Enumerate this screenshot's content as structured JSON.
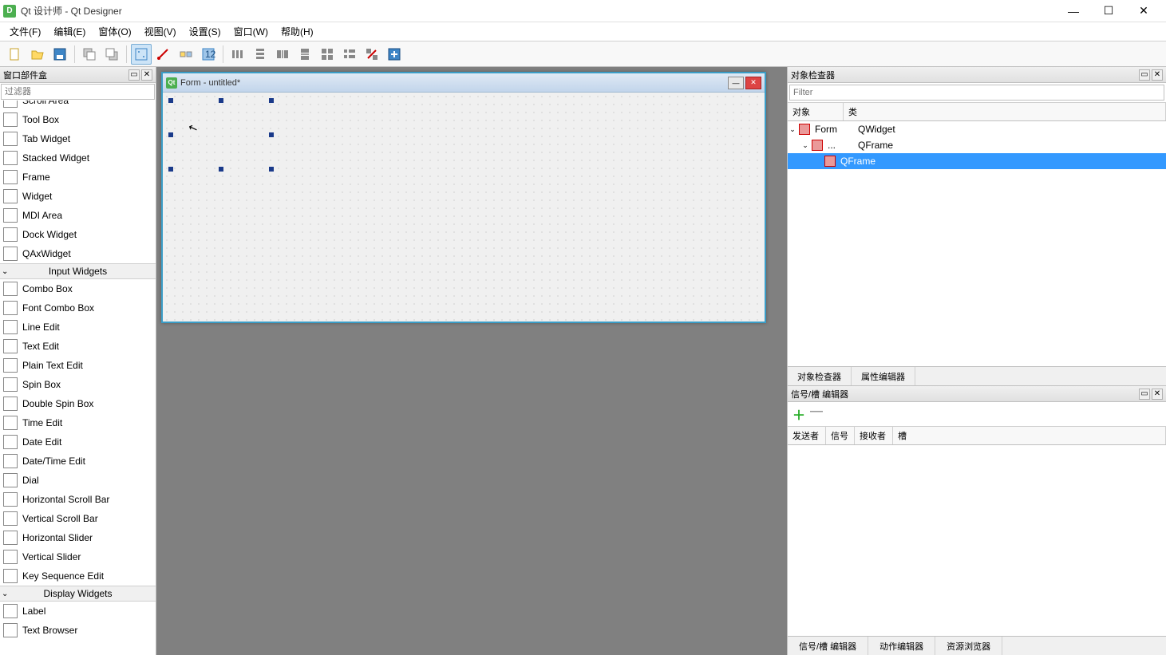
{
  "app": {
    "icon_letter": "D",
    "title": "Qt 设计师 - Qt Designer"
  },
  "menu": {
    "file": "文件(F)",
    "edit": "编辑(E)",
    "form": "窗体(O)",
    "view": "视图(V)",
    "settings": "设置(S)",
    "window": "窗口(W)",
    "help": "帮助(H)"
  },
  "widgetbox": {
    "title": "窗口部件盒",
    "filter_placeholder": "过滤器",
    "items_top": [
      {
        "name": "Scroll Area",
        "icon": "ic-gray",
        "clipped": true
      },
      {
        "name": "Tool Box",
        "icon": "ic-yellow"
      },
      {
        "name": "Tab Widget",
        "icon": "ic-green"
      },
      {
        "name": "Stacked Widget",
        "icon": "ic-green"
      },
      {
        "name": "Frame",
        "icon": "ic-stripe"
      },
      {
        "name": "Widget",
        "icon": "ic-stripe"
      },
      {
        "name": "MDI Area",
        "icon": "ic-gray"
      },
      {
        "name": "Dock Widget",
        "icon": "ic-gray"
      },
      {
        "name": "QAxWidget",
        "icon": "ic-gray"
      }
    ],
    "group_input": "Input Widgets",
    "items_input": [
      {
        "name": "Combo Box",
        "icon": "ic-gray"
      },
      {
        "name": "Font Combo Box",
        "icon": "ic-red"
      },
      {
        "name": "Line Edit",
        "icon": "ic-gray"
      },
      {
        "name": "Text Edit",
        "icon": "ic-blue"
      },
      {
        "name": "Plain Text Edit",
        "icon": "ic-blue"
      },
      {
        "name": "Spin Box",
        "icon": "ic-gray"
      },
      {
        "name": "Double Spin Box",
        "icon": "ic-gray"
      },
      {
        "name": "Time Edit",
        "icon": "ic-blue"
      },
      {
        "name": "Date Edit",
        "icon": "ic-gray"
      },
      {
        "name": "Date/Time Edit",
        "icon": "ic-gray"
      },
      {
        "name": "Dial",
        "icon": "ic-green"
      },
      {
        "name": "Horizontal Scroll Bar",
        "icon": "ic-yellow"
      },
      {
        "name": "Vertical Scroll Bar",
        "icon": "ic-yellow"
      },
      {
        "name": "Horizontal Slider",
        "icon": "ic-yellow"
      },
      {
        "name": "Vertical Slider",
        "icon": "ic-yellow"
      },
      {
        "name": "Key Sequence Edit",
        "icon": "ic-gray"
      }
    ],
    "group_display": "Display Widgets",
    "items_display": [
      {
        "name": "Label",
        "icon": "ic-yellow"
      },
      {
        "name": "Text Browser",
        "icon": "ic-blue"
      }
    ]
  },
  "canvas": {
    "form_title": "Form - untitled*",
    "qt_icon": "Qt"
  },
  "inspector": {
    "title": "对象检查器",
    "filter_placeholder": "Filter",
    "col_object": "对象",
    "col_class": "类",
    "tree": [
      {
        "indent": 0,
        "open": true,
        "obj": "Form",
        "cls": "QWidget",
        "icon": "ic-red"
      },
      {
        "indent": 1,
        "open": true,
        "obj": "...",
        "cls": "QFrame",
        "icon": "ic-red"
      },
      {
        "indent": 2,
        "open": false,
        "obj": "",
        "cls": "QFrame",
        "icon": "ic-red",
        "selected": true,
        "showcls_in_obj": true
      }
    ],
    "tab_inspector": "对象检查器",
    "tab_property": "属性编辑器"
  },
  "sigslot": {
    "title": "信号/槽 编辑器",
    "col_sender": "发送者",
    "col_signal": "信号",
    "col_receiver": "接收者",
    "col_slot": "槽",
    "tab_sigslot": "信号/槽 编辑器",
    "tab_action": "动作编辑器",
    "tab_resource": "资源浏览器"
  }
}
